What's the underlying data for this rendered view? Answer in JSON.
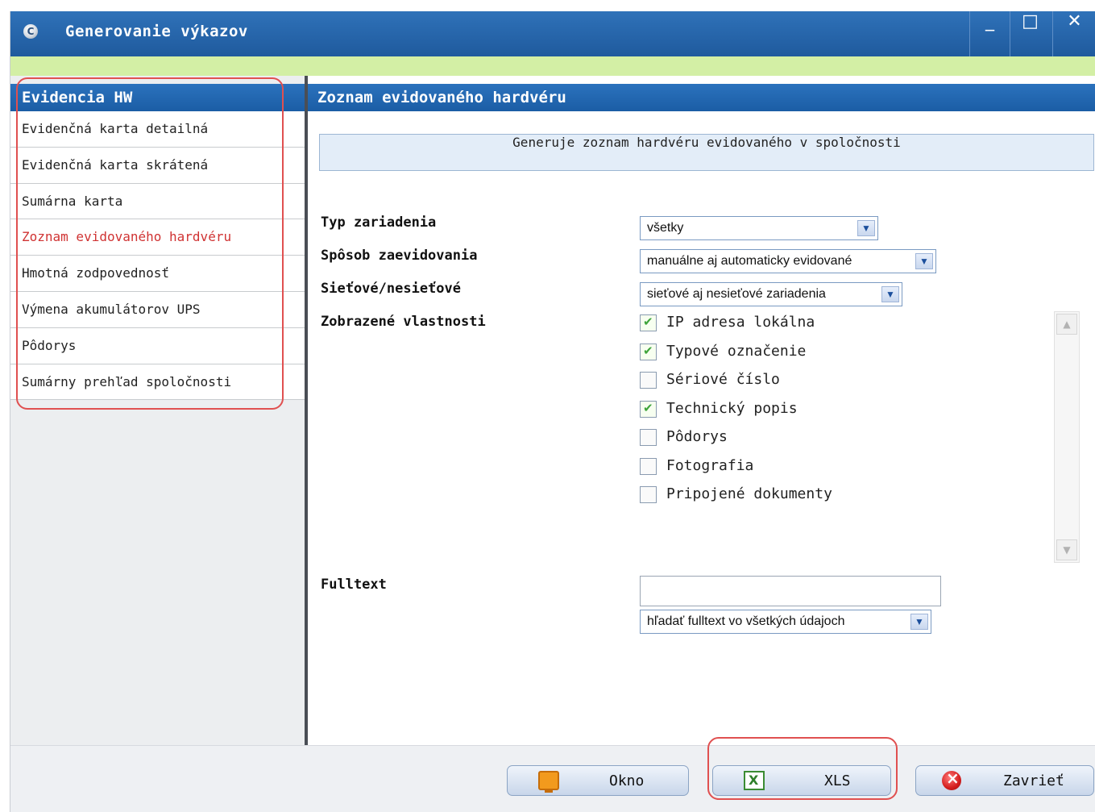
{
  "window": {
    "title": "Generovanie výkazov",
    "app_icon": "C",
    "minimize_glyph": "_",
    "maximize_glyph": "□",
    "close_glyph": "✕"
  },
  "sidebar": {
    "header": "Evidencia HW",
    "items": [
      {
        "label": "Evidenčná karta detailná"
      },
      {
        "label": "Evidenčná karta skrátená"
      },
      {
        "label": "Sumárna karta"
      },
      {
        "label": "Zoznam evidovaného hardvéru",
        "active": true
      },
      {
        "label": "Hmotná zodpovednosť"
      },
      {
        "label": "Výmena akumulátorov UPS"
      },
      {
        "label": "Pôdorys"
      },
      {
        "label": "Sumárny prehľad spoločnosti"
      }
    ]
  },
  "main": {
    "header": "Zoznam evidovaného hardvéru",
    "description": "Generuje zoznam hardvéru evidovaného v spoločnosti",
    "fields": {
      "device_type": {
        "label": "Typ zariadenia",
        "value": "všetky"
      },
      "registration_method": {
        "label": "Spôsob zaevidovania",
        "value": "manuálne aj automaticky evidované"
      },
      "network": {
        "label": "Sieťové/nesieťové",
        "value": "sieťové aj nesieťové zariadenia"
      },
      "properties": {
        "label": "Zobrazené vlastnosti",
        "options": [
          {
            "label": "IP adresa lokálna",
            "checked": true
          },
          {
            "label": "Typové označenie",
            "checked": true
          },
          {
            "label": "Sériové číslo",
            "checked": false
          },
          {
            "label": "Technický popis",
            "checked": true
          },
          {
            "label": "Pôdorys",
            "checked": false
          },
          {
            "label": "Fotografia",
            "checked": false
          },
          {
            "label": "Pripojené dokumenty",
            "checked": false
          }
        ]
      },
      "fulltext": {
        "label": "Fulltext",
        "value": "",
        "scope": "hľadať fulltext vo všetkých údajoch"
      }
    }
  },
  "buttons": {
    "window": "Okno",
    "xls": "XLS",
    "close": "Zavrieť"
  },
  "colors": {
    "titlebar": "#2f72b9",
    "accent_green": "#d3efa5",
    "active_item": "#d03333",
    "highlight": "#e05050"
  }
}
